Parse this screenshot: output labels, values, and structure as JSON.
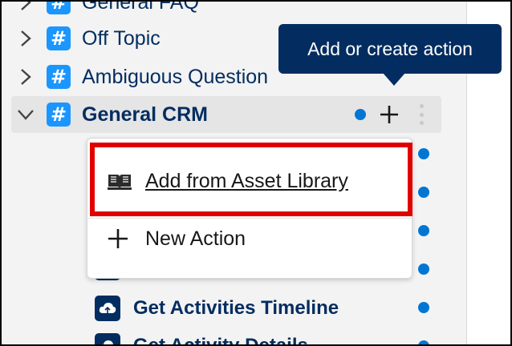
{
  "topics": [
    {
      "label": "General FAQ",
      "expanded": false
    },
    {
      "label": "Off Topic",
      "expanded": false
    },
    {
      "label": "Ambiguous Question",
      "expanded": false
    },
    {
      "label": "General CRM",
      "expanded": true
    }
  ],
  "hash_symbol": "#",
  "tooltip": {
    "text": "Add or create action"
  },
  "menu": {
    "items": [
      {
        "label": "Add from Asset Library",
        "icon": "book-icon"
      },
      {
        "label": "New Action",
        "icon": "plus-icon"
      }
    ]
  },
  "actions": [
    {
      "label": "Get Activities Timeline",
      "icon": "cloud-icon"
    },
    {
      "label": "Get Activity Details",
      "icon": "cloud-icon"
    }
  ],
  "colors": {
    "accent": "#1b96ff",
    "navy": "#032d60",
    "status_dot": "#0176d3",
    "highlight": "#e00000"
  }
}
